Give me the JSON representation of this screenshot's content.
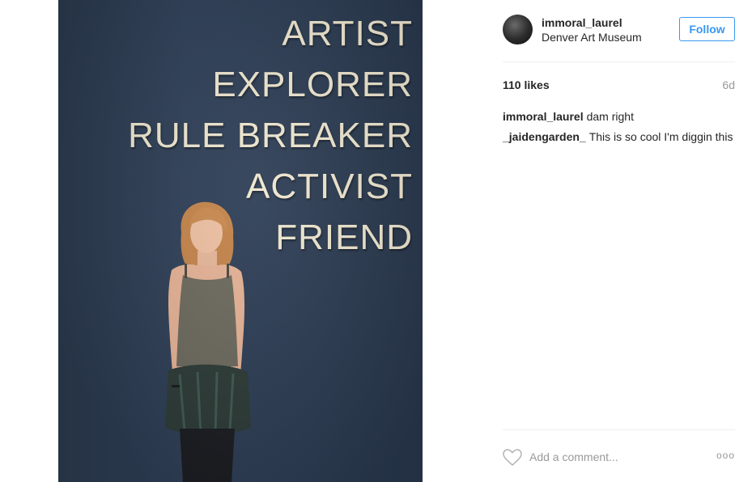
{
  "post": {
    "wall_words": [
      "ARTIST",
      "EXPLORER",
      "RULE BREAKER",
      "ACTIVIST",
      "FRIEND"
    ]
  },
  "header": {
    "username": "immoral_laurel",
    "location": "Denver Art Museum",
    "follow_label": "Follow"
  },
  "stats": {
    "likes": "110 likes",
    "age": "6d"
  },
  "comments": [
    {
      "user": "immoral_laurel",
      "text": "dam right"
    },
    {
      "user": "_jaidengarden_",
      "text": "This is so cool I'm diggin this"
    }
  ],
  "composer": {
    "placeholder": "Add a comment...",
    "more_label": "ooo"
  },
  "colors": {
    "accent": "#3897f0",
    "text": "#262626",
    "muted": "#999999",
    "wall": "#2f4058"
  },
  "icons": {
    "like": "heart-outline-icon",
    "more": "more-options-icon"
  }
}
